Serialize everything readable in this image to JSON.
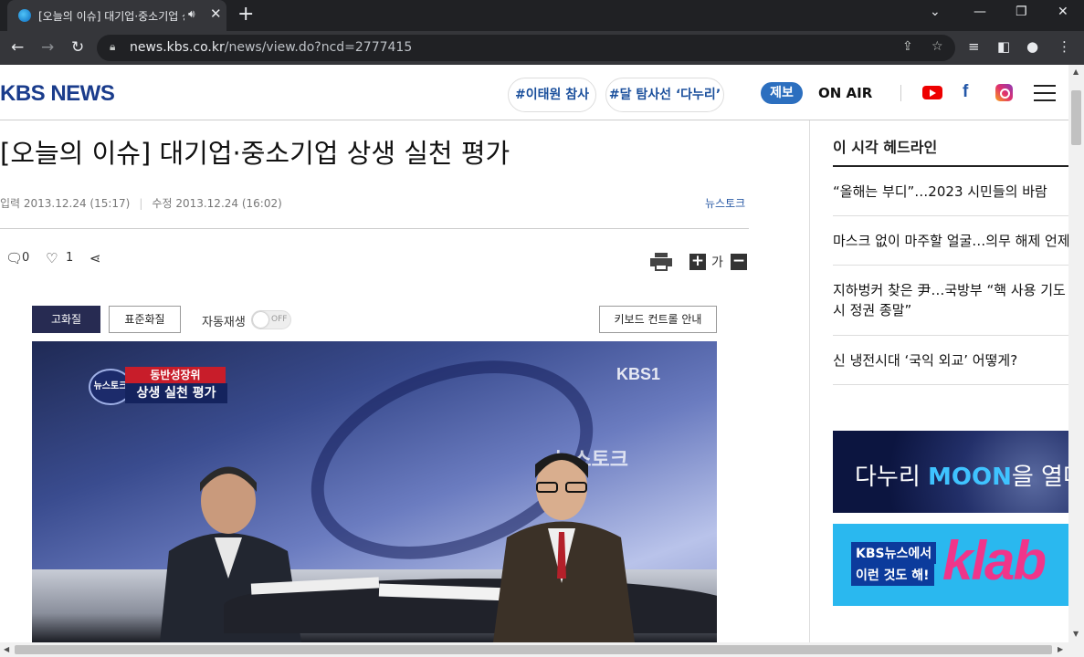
{
  "browser": {
    "tab_title": "[오늘의 이슈] 대기업·중소기업 상생 실천 평가",
    "url_host": "news.kbs.co.kr",
    "url_path": "/news/view.do?ncd=2777415"
  },
  "header": {
    "logo": "KBS NEWS",
    "tags": [
      "#이태원 참사",
      "#달 탐사선 ‘다누리’"
    ],
    "report_label": "제보",
    "onair_label": "ON AIR"
  },
  "article": {
    "headline": "[오늘의 이슈] 대기업·중소기업 상생 실천 평가",
    "published": "입력 2013.12.24 (15:17)",
    "modified": "수정 2013.12.24 (16:02)",
    "category": "뉴스토크",
    "comment_count": "0",
    "like_count": "1",
    "font_size_label": "가"
  },
  "player": {
    "quality_high": "고화질",
    "quality_std": "표준화질",
    "autoplay_label": "자동재생",
    "autoplay_state": "OFF",
    "keyboard_guide": "키보드 컨트롤 안내",
    "channel_logo": "KBS1",
    "caption_top": "동반성장위",
    "caption_bottom": "상생 실천 평가",
    "program_badge": "뉴스토크",
    "set_logo": "뉴스토크"
  },
  "sidebar": {
    "headline_title": "이 시각 헤드라인",
    "headlines": [
      "“올해는 부디”…2023 시민들의 바람",
      "마스크 없이 마주할 얼굴…의무 해제 언제",
      "지하벙커 찾은 尹…국방부 “핵 사용 기도 시 정권 종말”",
      "신 냉전시대 ‘국익 외교’ 어떻게?"
    ],
    "ad1_text_a": "다누리 ",
    "ad1_text_b": "MOON",
    "ad1_text_c": "을 열다",
    "ad2_line1": "KBS뉴스에서",
    "ad2_line2": "이런 것도 해!",
    "ad2_brand": "klab"
  }
}
